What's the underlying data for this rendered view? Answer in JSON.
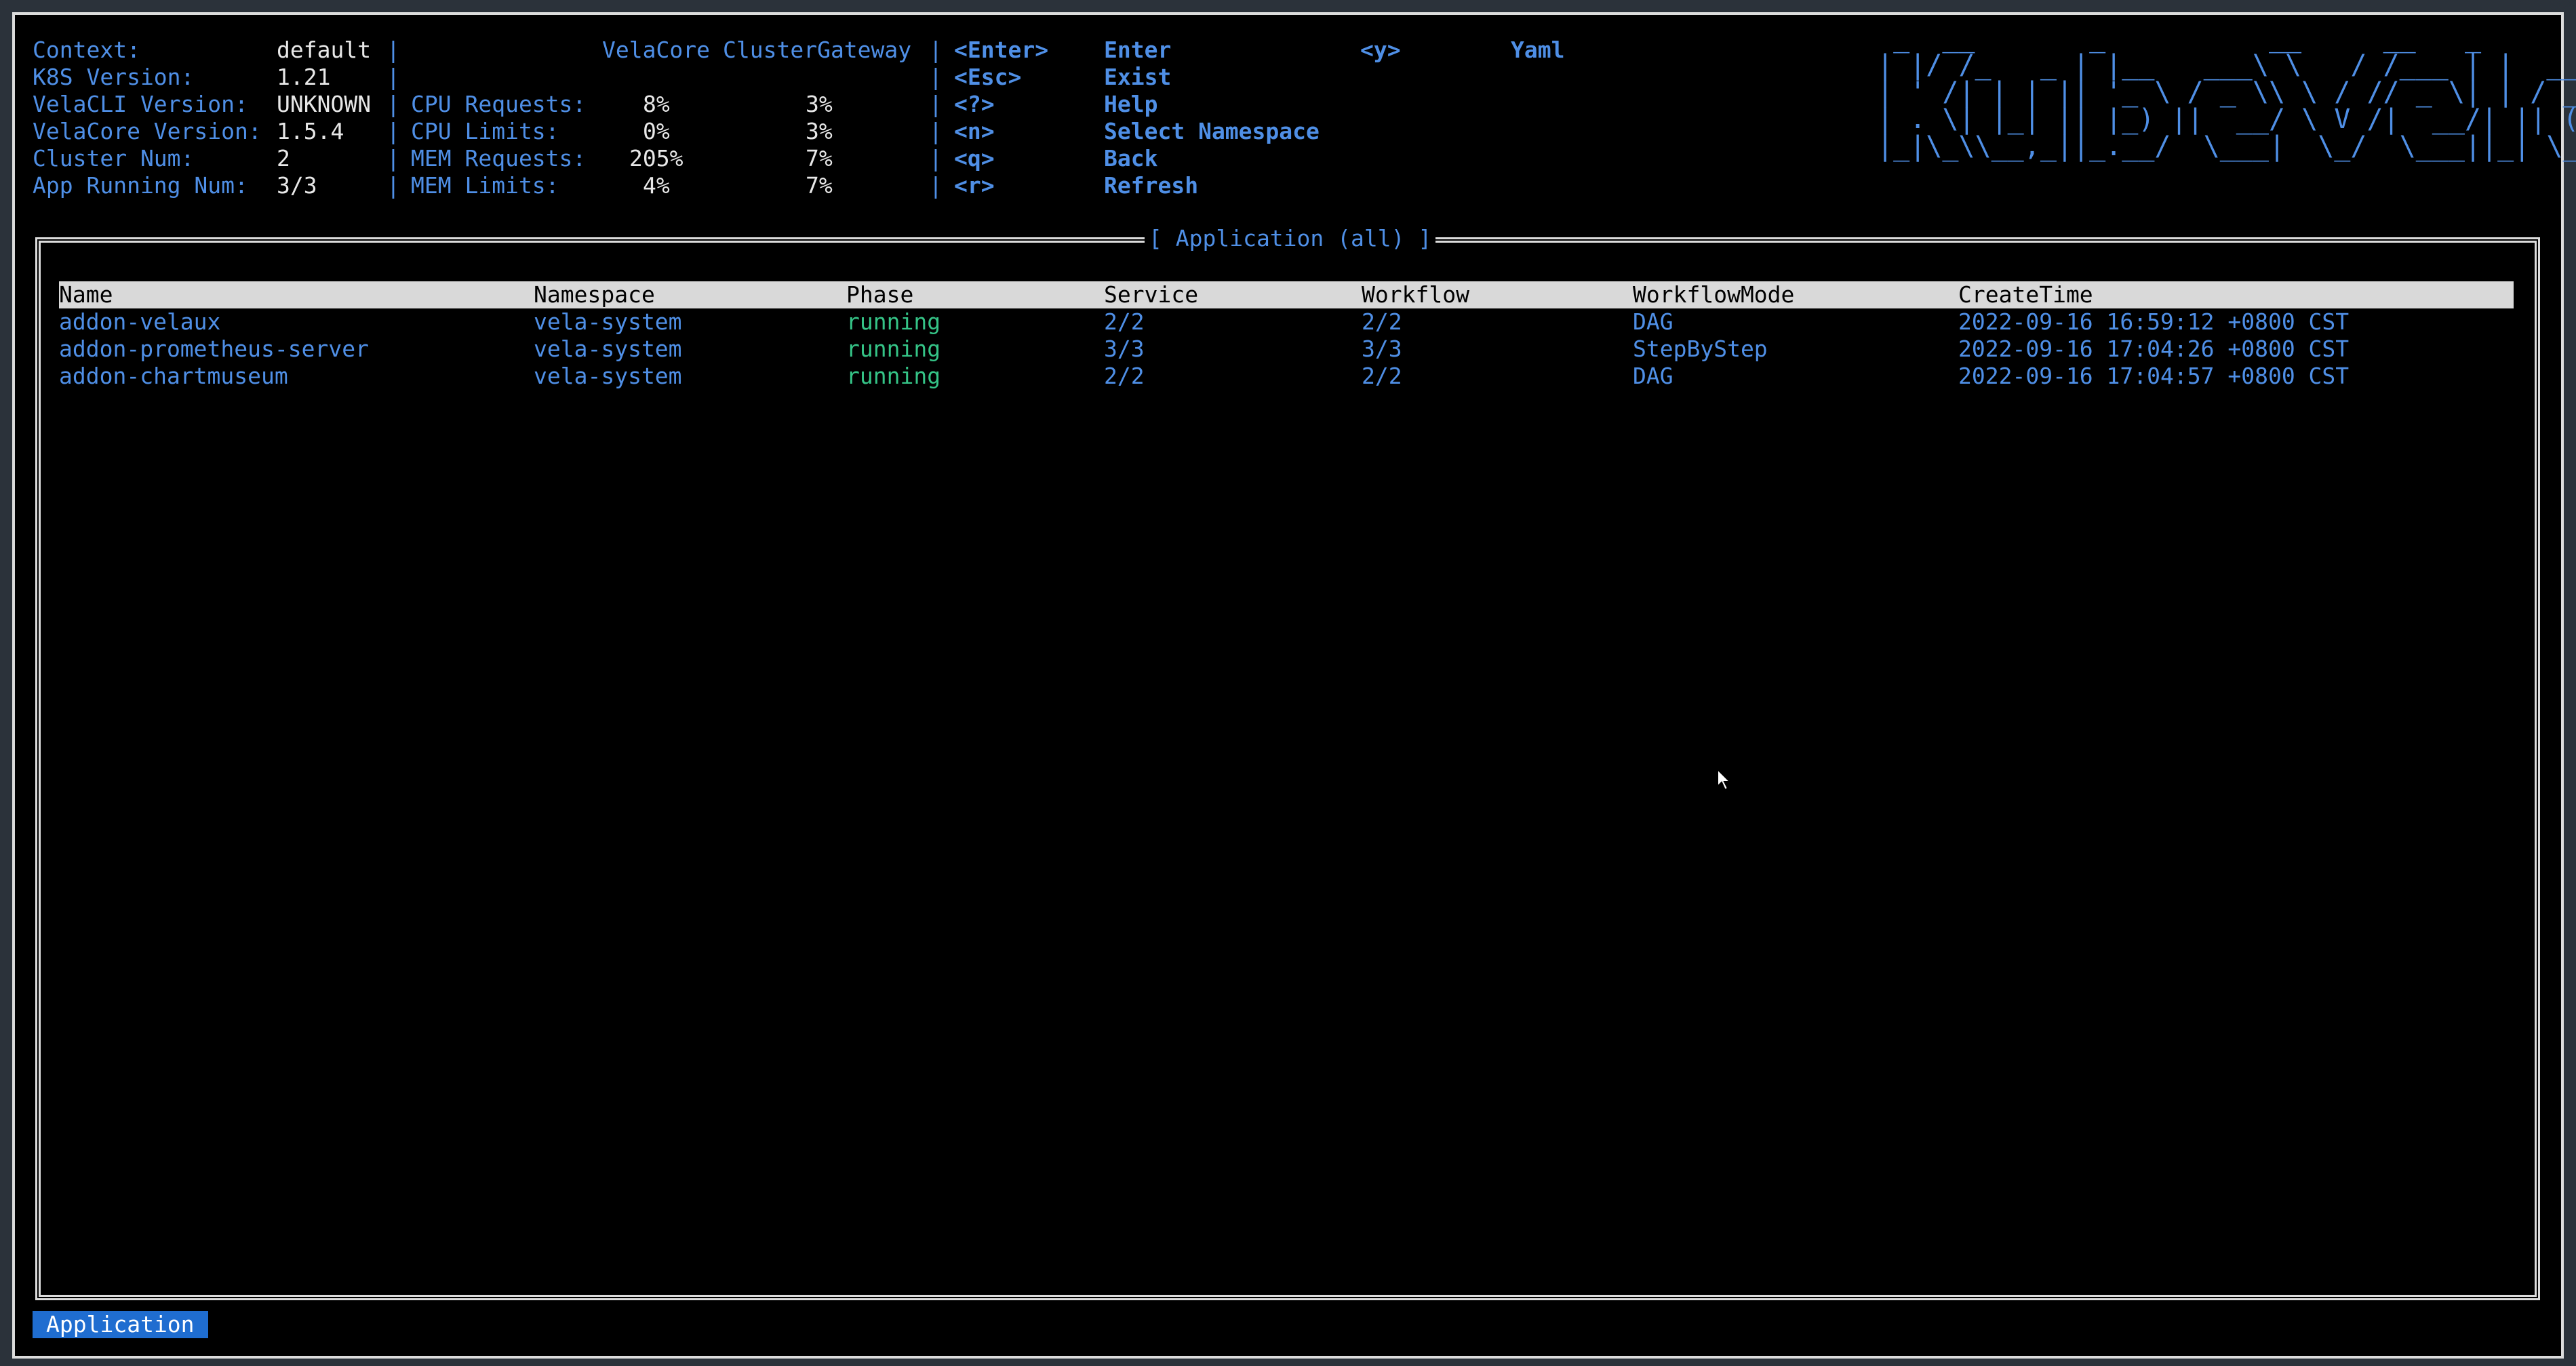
{
  "info": {
    "context_label": "Context:",
    "context_value": "default",
    "k8s_label": "K8S Version:",
    "k8s_value": "1.21",
    "cli_label": "VelaCLI Version:",
    "cli_value": "UNKNOWN",
    "core_label": "VelaCore Version:",
    "core_value": "1.5.4",
    "cluster_label": "Cluster Num:",
    "cluster_value": "2",
    "app_label": "App Running Num:",
    "app_value": "3/3"
  },
  "metrics": {
    "col1_header": "VelaCore",
    "col2_header": "ClusterGateway",
    "cpu_req_label": "CPU Requests:",
    "cpu_req_core": "8%",
    "cpu_req_gw": "3%",
    "cpu_lim_label": "CPU Limits:",
    "cpu_lim_core": "0%",
    "cpu_lim_gw": "3%",
    "mem_req_label": "MEM Requests:",
    "mem_req_core": "205%",
    "mem_req_gw": "7%",
    "mem_lim_label": "MEM Limits:",
    "mem_lim_core": "4%",
    "mem_lim_gw": "7%"
  },
  "keys": [
    {
      "key": "<Enter>",
      "action": "Enter"
    },
    {
      "key": "<Esc>",
      "action": "Exist"
    },
    {
      "key": "<?>",
      "action": "Help"
    },
    {
      "key": "<n>",
      "action": "Select Namespace"
    },
    {
      "key": "<q>",
      "action": "Back"
    },
    {
      "key": "<r>",
      "action": "Refresh"
    }
  ],
  "keys2": [
    {
      "key": "<y>",
      "action": "Yaml"
    }
  ],
  "logo_text": "kubeVela",
  "panel_title": "[ Application (all) ]",
  "table": {
    "headers": [
      "Name",
      "Namespace",
      "Phase",
      "Service",
      "Workflow",
      "WorkflowMode",
      "CreateTime"
    ],
    "rows": [
      [
        "addon-velaux",
        "vela-system",
        "running",
        "2/2",
        "2/2",
        "DAG",
        "2022-09-16 16:59:12 +0800 CST"
      ],
      [
        "addon-prometheus-server",
        "vela-system",
        "running",
        "3/3",
        "3/3",
        "StepByStep",
        "2022-09-16 17:04:26 +0800 CST"
      ],
      [
        "addon-chartmuseum",
        "vela-system",
        "running",
        "2/2",
        "2/2",
        "DAG",
        "2022-09-16 17:04:57 +0800 CST"
      ]
    ]
  },
  "crumb": "Application",
  "colors": {
    "accent": "#4f8fe6",
    "running": "#35c487",
    "crumb_bg": "#1f6dd0"
  }
}
